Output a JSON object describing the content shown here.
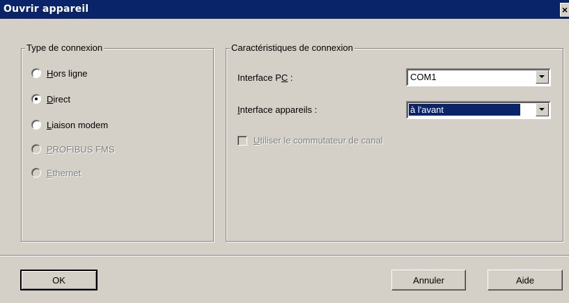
{
  "window": {
    "title": "Ouvrir appareil",
    "close": "×"
  },
  "connection_type": {
    "title": "Type de connexion",
    "options": [
      {
        "label": "Hors ligne",
        "mnemonic": "H",
        "rest": "ors ligne",
        "selected": false,
        "enabled": true
      },
      {
        "label": "Direct",
        "mnemonic": "D",
        "rest": "irect",
        "selected": true,
        "enabled": true
      },
      {
        "label": "Liaison modem",
        "mnemonic": "L",
        "rest": "iaison modem",
        "selected": false,
        "enabled": true
      },
      {
        "label": "PROFIBUS FMS",
        "mnemonic": "P",
        "rest": "ROFIBUS FMS",
        "selected": false,
        "enabled": false
      },
      {
        "label": "Ethernet",
        "mnemonic": "E",
        "rest": "thernet",
        "selected": false,
        "enabled": false
      }
    ]
  },
  "connection_props": {
    "title": "Caractéristiques de connexion",
    "pc_interface": {
      "label_pre": "Interface P",
      "label_mnemonic": "C",
      "label_post": " :",
      "value": "COM1"
    },
    "device_interface": {
      "label_mnemonic": "I",
      "label_rest": "nterface appareils :",
      "value": "à l'avant"
    },
    "channel_switch": {
      "mnemonic": "U",
      "rest": "tiliser le commutateur de canal",
      "checked": false,
      "enabled": false
    }
  },
  "buttons": {
    "ok": "OK",
    "cancel": "Annuler",
    "help": "Aide"
  }
}
